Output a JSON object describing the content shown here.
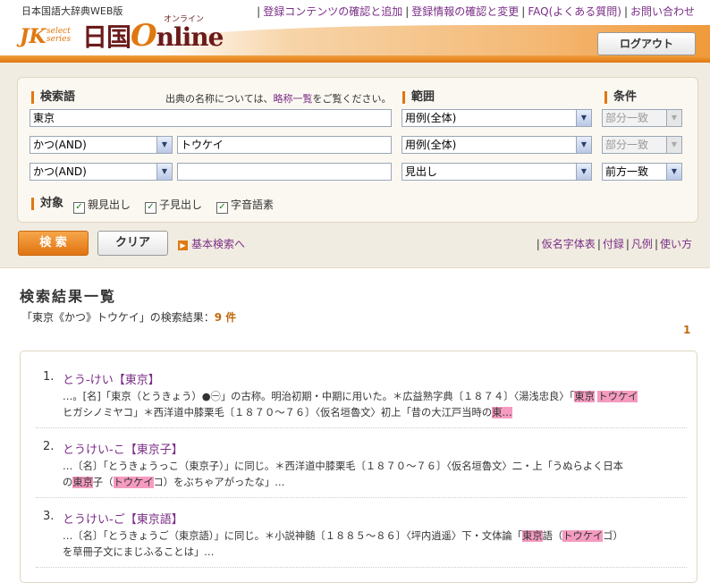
{
  "header": {
    "caption": "日本国語大辞典WEB版",
    "logo_jk": "JK",
    "logo_select": "select series",
    "logo_main_1": "日国",
    "logo_main_o": "O",
    "logo_main_2": "nline",
    "logo_online": "オンライン",
    "links": [
      "登録コンテンツの確認と追加",
      "登録情報の確認と変更",
      "FAQ(よくある質問)",
      "お問い合わせ"
    ],
    "logout": "ログアウト"
  },
  "search": {
    "label_keyword": "検索語",
    "note_before": "出典の名称については、",
    "note_link": "略称一覧",
    "note_after": "をご覧ください。",
    "label_range": "範囲",
    "label_condition": "条件",
    "row1": {
      "term": "東京",
      "range": "用例(全体)",
      "condition": "部分一致"
    },
    "row2": {
      "op": "かつ(AND)",
      "term": "トウケイ",
      "range": "用例(全体)",
      "condition": "部分一致"
    },
    "row3": {
      "op": "かつ(AND)",
      "term": "",
      "range": "見出し",
      "condition": "前方一致"
    },
    "label_target": "対象",
    "targets": [
      "親見出し",
      "子見出し",
      "字音語素"
    ],
    "search_btn": "検 索",
    "clear_btn": "クリア",
    "basic_link": "基本検索へ",
    "aux_links": [
      "仮名字体表",
      "付録",
      "凡例",
      "使い方"
    ]
  },
  "results": {
    "title": "検索結果一覧",
    "count_prefix": "「東京《かつ》トウケイ」の検索結果：",
    "count_value": "9 件",
    "page": "1",
    "items": [
      {
        "num": "1.",
        "headword": "とう‐けい【東京】",
        "l1a": "…。",
        "l1b": "[名]「東京（とうきょう）",
        "l1c": "」の古称。明治初期・中期に用いた。＊広益熟字典〔１８７４〕〈湯浅忠良〉「",
        "l1h1": "東京",
        "l1d": " ",
        "l1h2": "トウケイ",
        "l2a": "ヒガシノミヤコ」＊西洋道中膝栗毛〔１８７０〜７６〕〈仮名垣魯文〉初上「昔の大江戸当時の",
        "l2h": "東…"
      },
      {
        "num": "2.",
        "headword": "とうけい‐こ【東京子】",
        "l1": "…〔名〕「とうきょうっこ（東京子）」に同じ。＊西洋道中膝栗毛〔１８７０〜７６〕〈仮名垣魯文〉二・上「うぬらよく日本",
        "l2a": "の",
        "l2h1": "東京",
        "l2b": "子（",
        "l2h2": "トウケイ",
        "l2c": "コ）をぶちゃアがったな」…"
      },
      {
        "num": "3.",
        "headword": "とうけい‐ご【東京語】",
        "l1a": "…〔名〕「とうきょうご（東京語）」に同じ。＊小説神髄〔１８８５〜８６〕〈坪内逍遥〉下・文体論「",
        "l1h1": "東京",
        "l1b": "語（",
        "l1h2": "トウケイ",
        "l1c": "ゴ）",
        "l2": "を草冊子文にまじふることは」…"
      }
    ]
  }
}
